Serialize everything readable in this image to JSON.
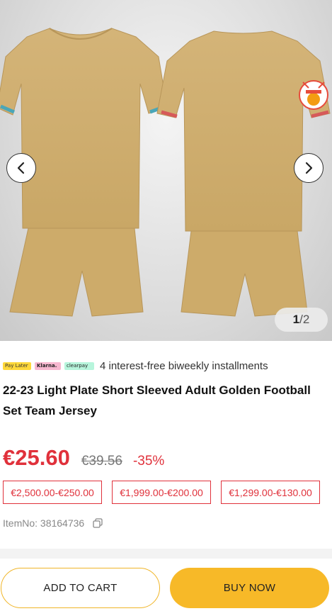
{
  "gallery": {
    "current": "1",
    "total": "/2",
    "prev_icon": "chevron-left-icon",
    "next_icon": "chevron-right-icon",
    "kit_color": "#cfae6e"
  },
  "payment": {
    "badges": [
      "Pay Later",
      "Klarna.",
      "clearpay"
    ],
    "text": "4 interest-free biweekly installments"
  },
  "product": {
    "title": "22-23 Light Plate Short Sleeved Adult Golden Football Set Team Jersey",
    "price": "€25.60",
    "old_price": "€39.56",
    "discount": "-35%",
    "tiers": [
      "€2,500.00-€250.00",
      "€1,999.00-€200.00",
      "€1,299.00-€130.00"
    ],
    "item_no": "ItemNo: 38164736"
  },
  "actions": {
    "add_to_cart": "ADD TO CART",
    "buy_now": "BUY NOW"
  },
  "colors": {
    "accent": "#e0313b",
    "button": "#f7b928"
  }
}
